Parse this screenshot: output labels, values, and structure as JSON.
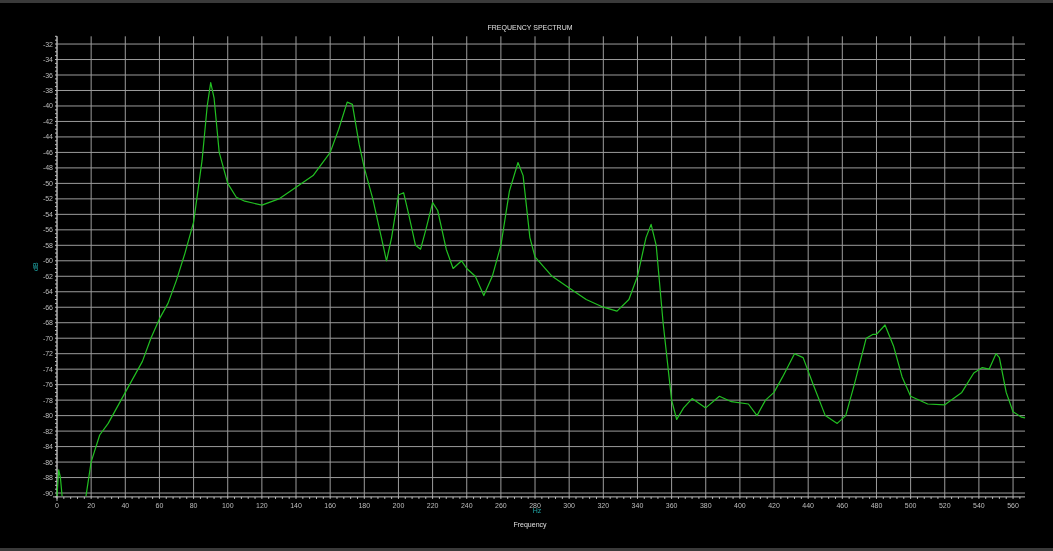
{
  "x_axis_unit": "Hz",
  "chart_data": {
    "type": "line",
    "title": "FREQUENCY SPECTRUM",
    "xlabel": "Frequency",
    "ylabel": "dB",
    "grid": true,
    "x": [
      0,
      1,
      2,
      3,
      4,
      17,
      20,
      25,
      30,
      40,
      50,
      55,
      60,
      65,
      70,
      75,
      80,
      85,
      88,
      90,
      92,
      95,
      100,
      105,
      110,
      120,
      130,
      140,
      150,
      160,
      165,
      170,
      173,
      177,
      180,
      185,
      190,
      193,
      196,
      200,
      203,
      206,
      210,
      213,
      216,
      220,
      223,
      228,
      232,
      237,
      240,
      245,
      250,
      255,
      260,
      265,
      270,
      273,
      277,
      280,
      290,
      300,
      310,
      320,
      328,
      335,
      340,
      345,
      348,
      351,
      355,
      360,
      363,
      367,
      372,
      380,
      388,
      395,
      405,
      410,
      415,
      420,
      425,
      432,
      437,
      443,
      450,
      457,
      462,
      467,
      474,
      478,
      480,
      485,
      490,
      495,
      500,
      510,
      520,
      530,
      537,
      542,
      546,
      550,
      552,
      556,
      560,
      565,
      567
    ],
    "series": [
      {
        "color": "#22c022",
        "values": [
          -90.4,
          -87,
          -88,
          -90.4,
          null,
          -90.4,
          -86,
          -82.5,
          -81,
          -77,
          -73,
          -70,
          -67.5,
          -65.5,
          -62.5,
          -59,
          -55,
          -47,
          -40,
          -37,
          -39,
          -46,
          -50,
          -51.8,
          -52.3,
          -52.8,
          -52,
          -50.5,
          -49,
          -46,
          -43,
          -39.5,
          -39.8,
          -45,
          -48,
          -52,
          -57,
          -60,
          -57,
          -51.5,
          -51.2,
          -54,
          -58,
          -58.5,
          -56,
          -52.5,
          -53.5,
          -58.5,
          -61,
          -60,
          -61,
          -62,
          -64.5,
          -62,
          -58,
          -51,
          -47.3,
          -49,
          -57,
          -59.5,
          -62,
          -63.5,
          -65,
          -66,
          -66.5,
          -65,
          -62,
          -57,
          -55.3,
          -58,
          -68,
          -78,
          -80.5,
          -79,
          -77.8,
          -79,
          -77.5,
          -78.2,
          -78.5,
          -80,
          -78,
          -77,
          -75,
          -72,
          -72.5,
          -76,
          -80,
          -81,
          -80,
          -76,
          -70,
          -69.5,
          -69.5,
          -68.3,
          -71,
          -75,
          -77.5,
          -78.5,
          -78.6,
          -77,
          -74.5,
          -73.8,
          -74,
          -72,
          -72.5,
          -77,
          -79.5,
          -80.2,
          -80.3
        ]
      }
    ],
    "xlim": [
      0,
      567
    ],
    "ylim": [
      -90.5,
      -31
    ],
    "xticks": [
      0,
      20,
      40,
      60,
      80,
      100,
      120,
      140,
      160,
      180,
      200,
      220,
      240,
      260,
      280,
      300,
      320,
      340,
      360,
      380,
      400,
      420,
      440,
      460,
      480,
      500,
      520,
      540,
      560
    ],
    "yticks": [
      -32,
      -34,
      -36,
      -38,
      -40,
      -42,
      -44,
      -46,
      -48,
      -50,
      -52,
      -54,
      -56,
      -58,
      -60,
      -62,
      -64,
      -66,
      -68,
      -70,
      -72,
      -74,
      -76,
      -78,
      -80,
      -82,
      -84,
      -86,
      -88,
      -90
    ]
  }
}
